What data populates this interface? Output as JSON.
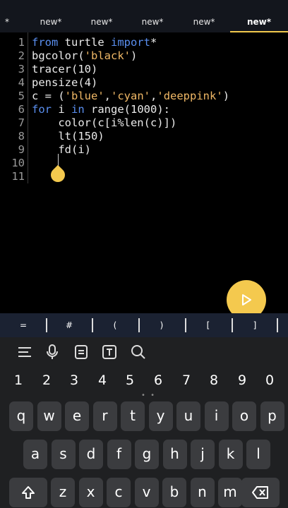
{
  "tabs": [
    {
      "label": "*"
    },
    {
      "label": "new*"
    },
    {
      "label": "new*"
    },
    {
      "label": "new*"
    },
    {
      "label": "new*"
    },
    {
      "label": "new*"
    }
  ],
  "colors": {
    "accent": "#f4c94e",
    "keyword": "#5a8ff0",
    "string": "#f0b866"
  },
  "editor": {
    "line_numbers": [
      "1",
      "2",
      "3",
      "4",
      "5",
      "6",
      "7",
      "8",
      "9",
      "10",
      "11"
    ],
    "lines": [
      [
        {
          "t": "from",
          "c": "kw"
        },
        {
          "t": " turtle ",
          "c": ""
        },
        {
          "t": "import",
          "c": "kw"
        },
        {
          "t": "*",
          "c": ""
        }
      ],
      [
        {
          "t": "bgcolor(",
          "c": ""
        },
        {
          "t": "'black'",
          "c": "str"
        },
        {
          "t": ")",
          "c": ""
        }
      ],
      [
        {
          "t": "tracer(10)",
          "c": ""
        }
      ],
      [
        {
          "t": "pensize(4)",
          "c": ""
        }
      ],
      [
        {
          "t": "c = (",
          "c": ""
        },
        {
          "t": "'blue'",
          "c": "str"
        },
        {
          "t": ",",
          "c": ""
        },
        {
          "t": "'cyan'",
          "c": "str"
        },
        {
          "t": ",",
          "c": ""
        },
        {
          "t": "'deeppink'",
          "c": "str"
        },
        {
          "t": ")",
          "c": ""
        }
      ],
      [
        {
          "t": "for",
          "c": "kw"
        },
        {
          "t": " i ",
          "c": ""
        },
        {
          "t": "in",
          "c": "kw"
        },
        {
          "t": " range(1000):",
          "c": ""
        }
      ],
      [
        {
          "t": "    color(c[i%len(c)])",
          "c": ""
        }
      ],
      [
        {
          "t": "    lt(150)",
          "c": ""
        }
      ],
      [
        {
          "t": "    fd(i)",
          "c": ""
        }
      ],
      [
        {
          "t": "",
          "c": ""
        }
      ],
      [
        {
          "t": "",
          "c": ""
        }
      ]
    ]
  },
  "run_button": {
    "icon": "play-icon"
  },
  "symbols": [
    "=",
    "#",
    "(",
    ")",
    "[",
    "]"
  ],
  "keyboard": {
    "toolbar_icons": [
      "menu-icon",
      "microphone-icon",
      "clipboard-icon",
      "text-icon",
      "search-icon"
    ],
    "numbers": [
      "1",
      "2",
      "3",
      "4",
      "5",
      "6",
      "7",
      "8",
      "9",
      "0"
    ],
    "row1": [
      "q",
      "w",
      "e",
      "r",
      "t",
      "y",
      "u",
      "i",
      "o",
      "p"
    ],
    "row2": [
      "a",
      "s",
      "d",
      "f",
      "g",
      "h",
      "j",
      "k",
      "l"
    ],
    "row3": [
      "z",
      "x",
      "c",
      "v",
      "b",
      "n",
      "m"
    ],
    "shift_icon": "shift-icon",
    "backspace_icon": "backspace-icon"
  }
}
